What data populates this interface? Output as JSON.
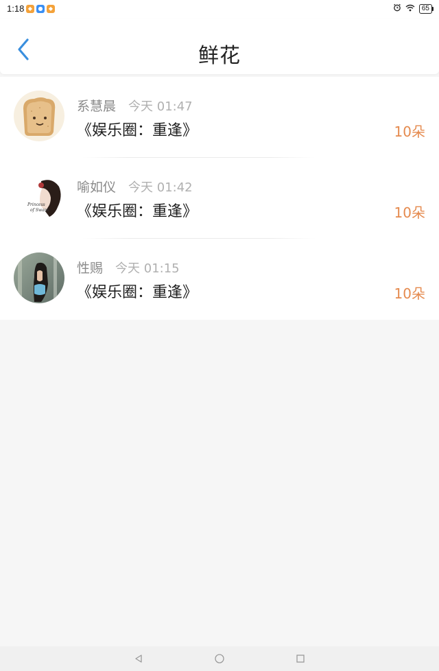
{
  "status_bar": {
    "time": "1:18",
    "battery": "65",
    "icons": [
      "alarm-icon",
      "wifi-icon",
      "battery-icon"
    ]
  },
  "header": {
    "title": "鲜花",
    "back_icon": "chevron-left-icon"
  },
  "colors": {
    "accent": "#3a8fde",
    "count": "#e58a4e",
    "username": "#8a8a8a",
    "timestamp": "#b0b0b0"
  },
  "records": [
    {
      "username": "系慧晨",
      "time": "今天 01:47",
      "book": "《娱乐圈：重逢》",
      "count": "10朵",
      "avatar": "toast-avatar"
    },
    {
      "username": "喻如仪",
      "time": "今天 01:42",
      "book": "《娱乐圈：重逢》",
      "count": "10朵",
      "avatar": "girl-portrait-avatar"
    },
    {
      "username": "性赐",
      "time": "今天 01:15",
      "book": "《娱乐圈：重逢》",
      "count": "10朵",
      "avatar": "girl-photo-avatar"
    }
  ],
  "nav": [
    "back-triangle-icon",
    "home-circle-icon",
    "recents-square-icon"
  ]
}
